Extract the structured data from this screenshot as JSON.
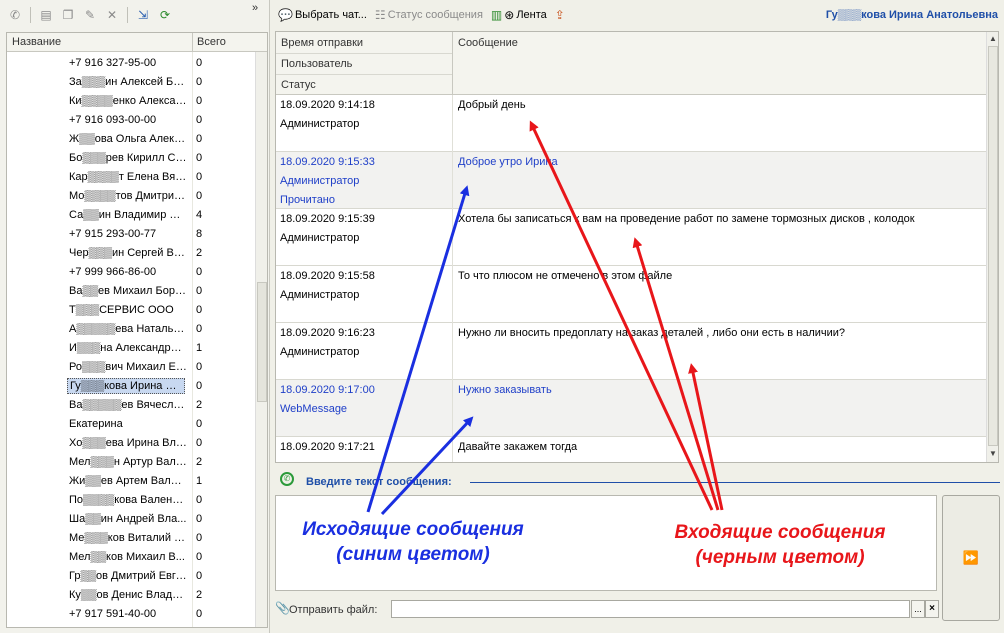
{
  "left_panel": {
    "collapse_label": "»",
    "columns": {
      "name": "Название",
      "total": "Всего"
    },
    "contacts": [
      {
        "name": "+7 916 327-95-00",
        "count": "0"
      },
      {
        "name": "За▒▒▒ин Алексей Бор...",
        "count": "0"
      },
      {
        "name": "Ки▒▒▒▒енко Александ...",
        "count": "0"
      },
      {
        "name": "+7 916 093-00-00",
        "count": "0"
      },
      {
        "name": "Ж▒▒ова Ольга Алекс...",
        "count": "0"
      },
      {
        "name": "Бо▒▒▒рев Кирилл Сер...",
        "count": "0"
      },
      {
        "name": "Кар▒▒▒▒т Елена Вяче...",
        "count": "0"
      },
      {
        "name": "Мо▒▒▒▒тов Дмитрий В...",
        "count": "0"
      },
      {
        "name": "Са▒▒ин Владимир Юр...",
        "count": "4"
      },
      {
        "name": "+7 915 293-00-77",
        "count": "8"
      },
      {
        "name": "Чер▒▒▒ин Сергей Вл...",
        "count": "2"
      },
      {
        "name": "+7 999 966-86-00",
        "count": "0"
      },
      {
        "name": "Ва▒▒ев Михаил Борис...",
        "count": "0"
      },
      {
        "name": "Т▒▒▒СЕРВИС ООО",
        "count": "0"
      },
      {
        "name": "А▒▒▒▒▒ева Наталья ...",
        "count": "0"
      },
      {
        "name": "И▒▒▒на Александра ...",
        "count": "1"
      },
      {
        "name": "Ро▒▒▒вич Михаил Евге...",
        "count": "0"
      },
      {
        "name": "Гу▒▒▒кова Ирина Ана...",
        "count": "0",
        "selected": true
      },
      {
        "name": "Ва▒▒▒▒▒ев Вячеслав ...",
        "count": "2"
      },
      {
        "name": "Екатерина",
        "count": "0"
      },
      {
        "name": "Хо▒▒▒ева Ирина Влад...",
        "count": "0"
      },
      {
        "name": "Мел▒▒▒н Артур Вале...",
        "count": "2"
      },
      {
        "name": "Жи▒▒ев Артем Валер...",
        "count": "1"
      },
      {
        "name": "По▒▒▒▒кова Валенти...",
        "count": "0"
      },
      {
        "name": "Ша▒▒ин Андрей Вла...",
        "count": "0"
      },
      {
        "name": "Ме▒▒▒ков Виталий Вл...",
        "count": "0"
      },
      {
        "name": "Мел▒▒ков Михаил В...",
        "count": "0"
      },
      {
        "name": "Гр▒▒ов Дмитрий Евге...",
        "count": "0"
      },
      {
        "name": "Ку▒▒ов Денис Влади...",
        "count": "2"
      },
      {
        "name": "+7 917 591-40-00",
        "count": "0"
      }
    ]
  },
  "right_toolbar": {
    "choose_chat": "Выбрать чат...",
    "message_status": "Статус сообщения",
    "feed": "Лента",
    "user_name": "Гу▒▒▒кова Ирина Анатольевна"
  },
  "messages": {
    "columns": {
      "sent_time": "Время отправки",
      "user": "Пользователь",
      "status": "Статус",
      "message": "Сообщение"
    },
    "rows": [
      {
        "time": "18.09.2020 9:14:18",
        "user": "Администратор",
        "status": "",
        "text": "Добрый день",
        "outgoing": false
      },
      {
        "time": "18.09.2020 9:15:33",
        "user": "Администратор",
        "status": "Прочитано",
        "text": "Доброе утро Ирина",
        "outgoing": true
      },
      {
        "time": "18.09.2020 9:15:39",
        "user": "Администратор",
        "status": "",
        "text": "Хотела бы записаться к вам на проведение работ по замене тормозных дисков , колодок",
        "outgoing": false
      },
      {
        "time": "18.09.2020 9:15:58",
        "user": "Администратор",
        "status": "",
        "text": "То что плюсом не отмечено в этом файле",
        "outgoing": false
      },
      {
        "time": "18.09.2020 9:16:23",
        "user": "Администратор",
        "status": "",
        "text": "Нужно ли вносить предоплату на заказ деталей , либо они есть в наличии?",
        "outgoing": false
      },
      {
        "time": "18.09.2020 9:17:00",
        "user": "WebMessage",
        "status": "",
        "text": "Нужно заказывать",
        "outgoing": true
      },
      {
        "time": "18.09.2020 9:17:21",
        "user": "",
        "status": "",
        "text": "Давайте закажем тогда",
        "outgoing": false
      }
    ]
  },
  "compose": {
    "label": "Введите текст сообщения:",
    "send_glyph": "⏩",
    "file_label": "Отправить файл:",
    "file_value": "",
    "browse_label": "...",
    "clear_label": "×"
  },
  "annotations": {
    "outgoing_line1": "Исходящие сообщения",
    "outgoing_line2": "(синим цветом)",
    "incoming_line1": "Входящие сообщения",
    "incoming_line2": "(черным цветом)",
    "outgoing_color": "#1a2fe0",
    "incoming_color": "#e8161a"
  },
  "icons": {
    "left_toolbar": [
      "new-contact-icon",
      "new-folder-icon",
      "copy-icon",
      "edit-icon",
      "delete-icon",
      "import-icon",
      "refresh-icon"
    ],
    "right_toolbar": [
      "chat-select-icon",
      "status-icon",
      "feed-icon",
      "upload-icon"
    ],
    "compose": [
      "whatsapp-icon",
      "paperclip-icon",
      "send-icon"
    ]
  }
}
